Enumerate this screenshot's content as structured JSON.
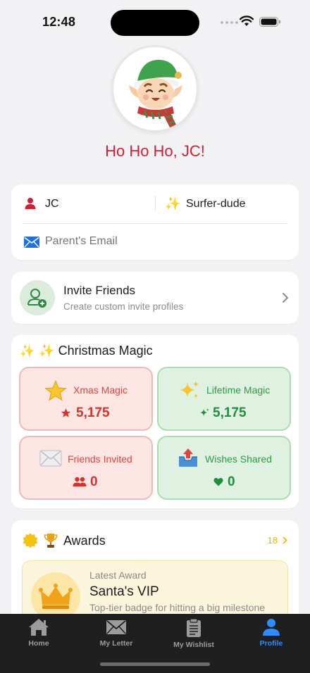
{
  "status_bar": {
    "time": "12:48"
  },
  "header": {
    "greeting": "Ho Ho Ho, JC!"
  },
  "profile": {
    "name": "JC",
    "nickname": "Surfer-dude",
    "email_value": "",
    "email_placeholder": "Parent's Email"
  },
  "invite": {
    "title": "Invite Friends",
    "subtitle": "Create custom invite profiles"
  },
  "christmas_magic": {
    "title": "✨ Christmas Magic",
    "tiles": [
      {
        "label": "Xmas Magic",
        "value": "5,175",
        "icon": "star-icon",
        "value_icon": "star-small-icon"
      },
      {
        "label": "Lifetime Magic",
        "value": "5,175",
        "icon": "sparkles-icon",
        "value_icon": "sparkle-small-icon"
      },
      {
        "label": "Friends Invited",
        "value": "0",
        "icon": "envelope-icon",
        "value_icon": "people-icon"
      },
      {
        "label": "Wishes Shared",
        "value": "0",
        "icon": "outbox-tray-icon",
        "value_icon": "heart-icon"
      }
    ]
  },
  "awards": {
    "title": "Awards",
    "count": "18",
    "latest": {
      "kicker": "Latest Award",
      "title": "Santa's VIP",
      "description": "Top-tier badge for hitting a big milestone"
    }
  },
  "tabbar": {
    "items": [
      {
        "label": "Home",
        "icon": "house-icon",
        "active": false
      },
      {
        "label": "My Letter",
        "icon": "envelope-icon",
        "active": false
      },
      {
        "label": "My Wishlist",
        "icon": "clipboard-icon",
        "active": false
      },
      {
        "label": "Profile",
        "icon": "person-icon",
        "active": true
      }
    ]
  },
  "colors": {
    "accent_red": "#d51e35",
    "active_tab": "#2f8cff",
    "gold": "#f0b400"
  }
}
